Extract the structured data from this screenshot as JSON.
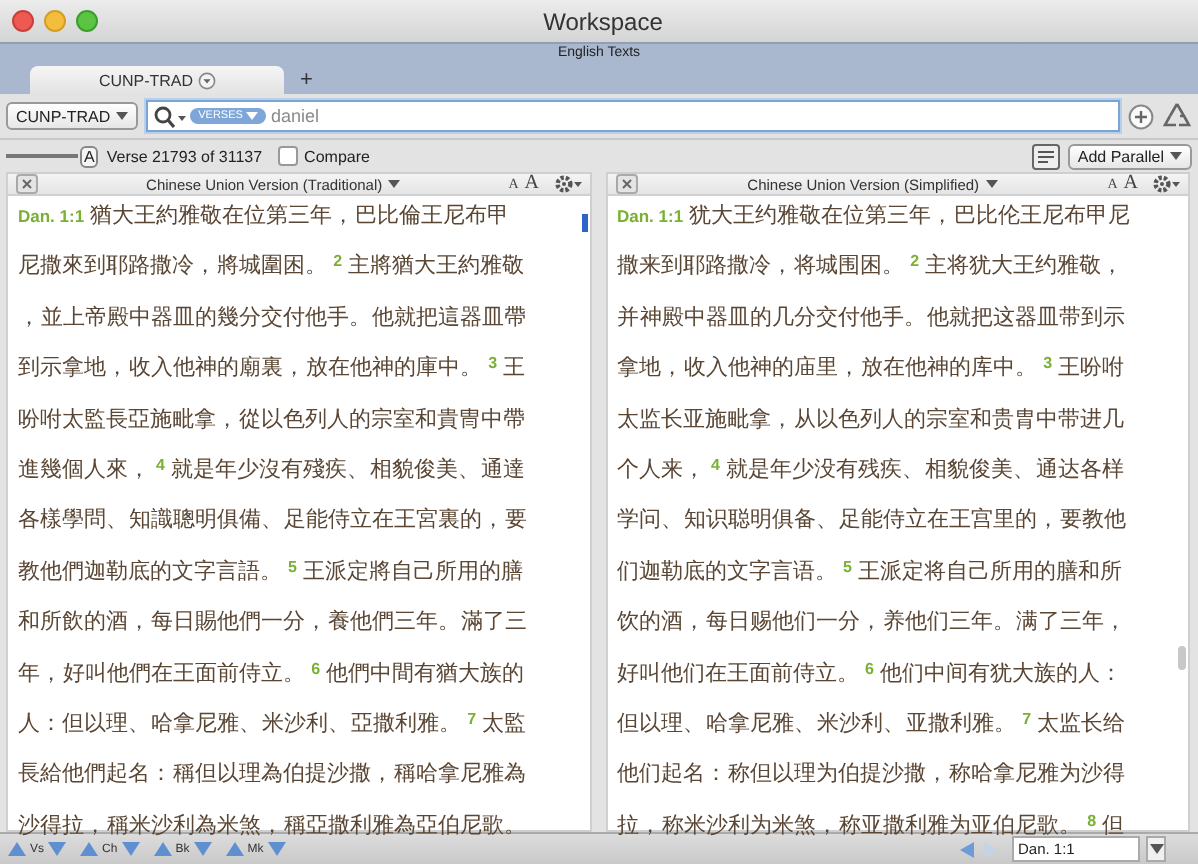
{
  "window": {
    "title": "Workspace",
    "subtitle": "English Texts"
  },
  "tabs": [
    {
      "label": "CUNP-TRAD",
      "selected": true
    }
  ],
  "new_tab": "+",
  "toolbar": {
    "module": "CUNP-TRAD",
    "search_scope": "VERSES",
    "search_value": "daniel"
  },
  "info_bar": {
    "slider": {
      "level": 1.0
    },
    "slider_label": "A",
    "verse_count": "Verse 21793 of 31137",
    "compare": {
      "label": "Compare",
      "checked": false
    },
    "add_parallel": "Add Parallel"
  },
  "panes": [
    {
      "title": "Chinese Union Version (Traditional)",
      "font_small": "A",
      "font_large": "A",
      "lines": [
        [
          {
            "kind": "reference",
            "text": "Dan. 1:1"
          },
          {
            "kind": "text",
            "text": "猶大王約雅敬在位第三年， 巴比倫王尼布甲"
          }
        ],
        [
          {
            "kind": "text",
            "text": "尼撒來到耶路撒冷， 將城圍困。"
          },
          {
            "kind": "verse",
            "text": "2"
          },
          {
            "kind": "text",
            "text": "主將猶大王約雅敬"
          }
        ],
        [
          {
            "kind": "text",
            "text": "， 並上帝殿中器皿的幾分交付他手。 他就把這器皿帶"
          }
        ],
        [
          {
            "kind": "text",
            "text": "到示拿地， 收入他神的廟裏， 放在他神的庫中。"
          },
          {
            "kind": "verse",
            "text": "3"
          },
          {
            "kind": "text",
            "text": "王"
          }
        ],
        [
          {
            "kind": "text",
            "text": "吩咐太監長亞施毗拿， 從以色列人的宗室和貴冑中帶"
          }
        ],
        [
          {
            "kind": "text",
            "text": "進幾個人來，"
          },
          {
            "kind": "verse",
            "text": "4"
          },
          {
            "kind": "text",
            "text": "就是年少沒有殘疾、 相貌俊美、 通達"
          }
        ],
        [
          {
            "kind": "text",
            "text": "各樣學問、 知識聰明俱備、 足能侍立在王宮裏的， 要"
          }
        ],
        [
          {
            "kind": "text",
            "text": "教他們迦勒底的文字言語。"
          },
          {
            "kind": "verse",
            "text": "5"
          },
          {
            "kind": "text",
            "text": "王派定將自己所用的膳"
          }
        ],
        [
          {
            "kind": "text",
            "text": "和所飲的酒， 每日賜他們一分， 養他們三年。 滿了三"
          }
        ],
        [
          {
            "kind": "text",
            "text": "年， 好叫他們在王面前侍立。"
          },
          {
            "kind": "verse",
            "text": "6"
          },
          {
            "kind": "text",
            "text": "他們中間有猶大族的"
          }
        ],
        [
          {
            "kind": "text",
            "text": "人：但以理、 哈拿尼雅、 米沙利、 亞撒利雅。"
          },
          {
            "kind": "verse",
            "text": "7"
          },
          {
            "kind": "text",
            "text": "太監"
          }
        ],
        [
          {
            "kind": "text",
            "text": "長給他們起名： 稱但以理為伯提沙撒， 稱哈拿尼雅為"
          }
        ],
        [
          {
            "kind": "text",
            "text": "沙得拉， 稱米沙利為米煞， 稱亞撒利雅為亞伯尼歌。"
          }
        ]
      ]
    },
    {
      "title": "Chinese Union Version (Simplified)",
      "font_small": "A",
      "font_large": "A",
      "lines": [
        [
          {
            "kind": "reference",
            "text": "Dan. 1:1"
          },
          {
            "kind": "text",
            "text": "犹大王约雅敬在位第三年， 巴比伦王尼布甲尼"
          }
        ],
        [
          {
            "kind": "text",
            "text": "撒来到耶路撒冷， 将城围困。"
          },
          {
            "kind": "verse",
            "text": "2"
          },
          {
            "kind": "text",
            "text": "主将犹大王约雅敬，"
          }
        ],
        [
          {
            "kind": "text",
            "text": "并 神殿中器皿的几分交付他手。 他就把这器皿带到示"
          }
        ],
        [
          {
            "kind": "text",
            "text": "拿地， 收入他神的庙里， 放在他神的库中。"
          },
          {
            "kind": "verse",
            "text": "3"
          },
          {
            "kind": "text",
            "text": "王吩咐"
          }
        ],
        [
          {
            "kind": "text",
            "text": "太监长亚施毗拿， 从以色列人的宗室和贵胄中带进几"
          }
        ],
        [
          {
            "kind": "text",
            "text": "个人来，"
          },
          {
            "kind": "verse",
            "text": "4"
          },
          {
            "kind": "text",
            "text": "就是年少没有残疾、 相貌俊美、 通达各样"
          }
        ],
        [
          {
            "kind": "text",
            "text": "学问、 知识聪明俱备、 足能侍立在王宫里的， 要教他"
          }
        ],
        [
          {
            "kind": "text",
            "text": "们迦勒底的文字言语。"
          },
          {
            "kind": "verse",
            "text": "5"
          },
          {
            "kind": "text",
            "text": "王派定将自己所用的膳和所"
          }
        ],
        [
          {
            "kind": "text",
            "text": "饮的酒， 每日赐他们一分， 养他们三年。 满了三年，"
          }
        ],
        [
          {
            "kind": "text",
            "text": "好叫他们在王面前侍立。"
          },
          {
            "kind": "verse",
            "text": "6"
          },
          {
            "kind": "text",
            "text": "他们中间有犹大族的人："
          }
        ],
        [
          {
            "kind": "text",
            "text": "但以理、 哈拿尼雅、 米沙利、 亚撒利雅。"
          },
          {
            "kind": "verse",
            "text": "7"
          },
          {
            "kind": "text",
            "text": "太监长给"
          }
        ],
        [
          {
            "kind": "text",
            "text": "他们起名： 称但以理为伯提沙撒， 称哈拿尼雅为沙得"
          }
        ],
        [
          {
            "kind": "text",
            "text": "拉， 称米沙利为米煞， 称亚撒利雅为亚伯尼歌。"
          },
          {
            "kind": "verse",
            "text": "8"
          },
          {
            "kind": "text",
            "text": "但"
          }
        ]
      ]
    }
  ],
  "navigator": [
    "Vs",
    "Ch",
    "Bk",
    "Mk"
  ],
  "reference_field": "Dan. 1:1"
}
